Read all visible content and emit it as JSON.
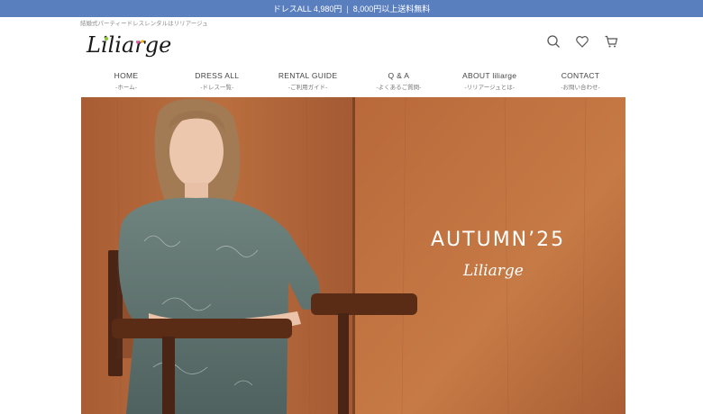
{
  "announcement": {
    "left": "ドレスALL 4,980円",
    "separator": "|",
    "right": "8,000円以上送料無料"
  },
  "header": {
    "tagline": "結婚式パーティードレスレンタルはリリアージュ",
    "logo_text": "Liliarge",
    "icons": [
      "search-icon",
      "heart-icon",
      "cart-icon"
    ]
  },
  "nav": [
    {
      "label": "HOME",
      "sub": "-ホーム-"
    },
    {
      "label": "DRESS ALL",
      "sub": "-ドレス一覧-"
    },
    {
      "label": "RENTAL GUIDE",
      "sub": "-ご利用ガイド-"
    },
    {
      "label": "Q & A",
      "sub": "-よくあるご質問-"
    },
    {
      "label": "ABOUT liliarge",
      "sub": "-リリアージュとは-"
    },
    {
      "label": "CONTACT",
      "sub": "-お問い合わせ-"
    }
  ],
  "hero": {
    "title": "AUTUMN’25",
    "brand": "Liliarge"
  },
  "colors": {
    "announcement_bg": "#5a7fbf",
    "wood": "#b86a3c",
    "dress": "#5d716e"
  }
}
